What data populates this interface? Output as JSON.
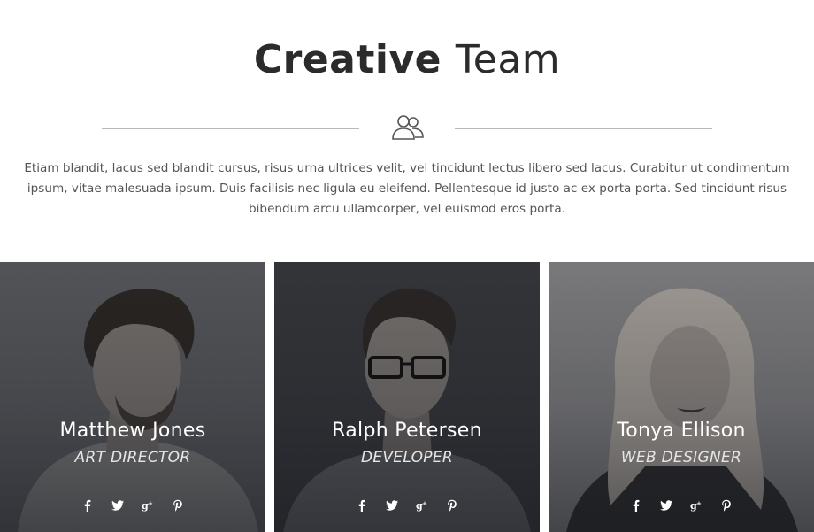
{
  "header": {
    "title_bold": "Creative",
    "title_light": "Team",
    "intro": "Etiam blandit, lacus sed blandit cursus, risus urna ultrices velit, vel tincidunt lectus libero sed lacus. Curabitur ut condimentum ipsum, vitae malesuada ipsum. Duis facilisis nec ligula eu eleifend. Pellentesque id justo ac ex porta porta. Sed tincidunt risus bibendum arcu ullamcorper, vel euismod eros porta.",
    "icon": "team-users-icon"
  },
  "members": [
    {
      "name": "Matthew Jones",
      "role": "ART DIRECTOR",
      "socials": [
        "facebook-icon",
        "twitter-icon",
        "google-plus-icon",
        "pinterest-icon"
      ]
    },
    {
      "name": "Ralph Petersen",
      "role": "DEVELOPER",
      "socials": [
        "facebook-icon",
        "twitter-icon",
        "google-plus-icon",
        "pinterest-icon"
      ]
    },
    {
      "name": "Tonya Ellison",
      "role": "WEB DESIGNER",
      "socials": [
        "facebook-icon",
        "twitter-icon",
        "google-plus-icon",
        "pinterest-icon"
      ]
    }
  ],
  "colors": {
    "title": "#2b2b2b",
    "text": "#555555",
    "divider": "#b9b9b9",
    "card_text": "#ffffff"
  }
}
